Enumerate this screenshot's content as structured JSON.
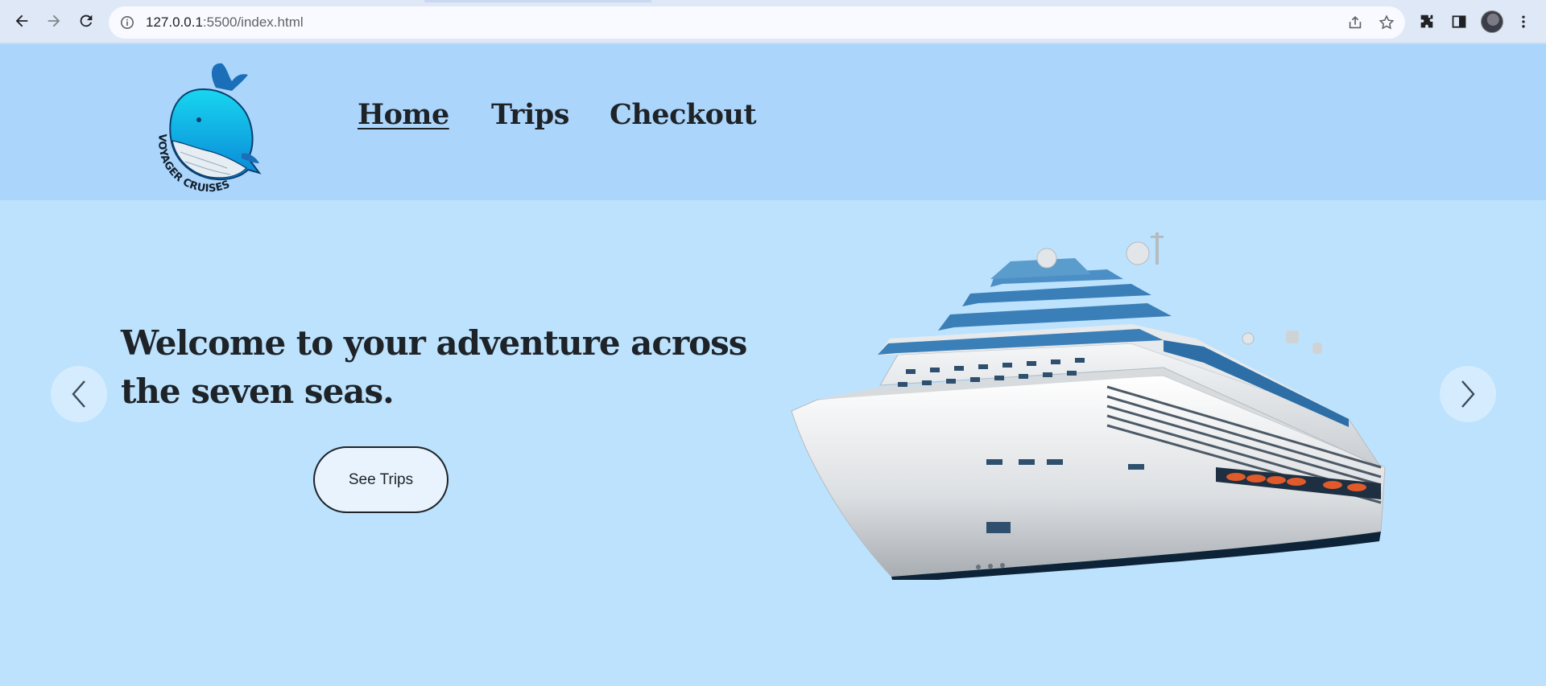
{
  "browser": {
    "url_host": "127.0.0.1",
    "url_rest": ":5500/index.html"
  },
  "site": {
    "logo_text": "VOYAGER CRUISES",
    "nav": [
      {
        "label": "Home",
        "active": true
      },
      {
        "label": "Trips",
        "active": false
      },
      {
        "label": "Checkout",
        "active": false
      }
    ]
  },
  "hero": {
    "title": "Welcome to your adventure across the seven seas.",
    "cta_label": "See Trips"
  },
  "colors": {
    "header_bg": "#acd5fb",
    "hero_bg": "#bde2fd",
    "text": "#1e2328",
    "button_bg": "#e8f3fd"
  }
}
